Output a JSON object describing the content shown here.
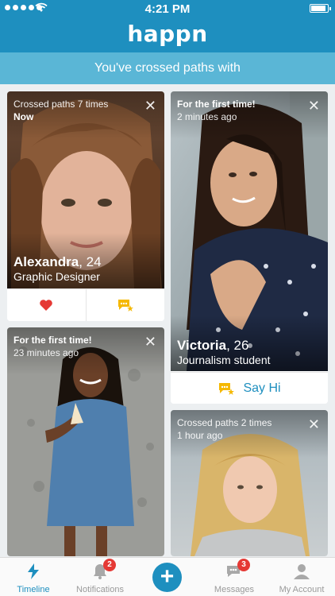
{
  "status": {
    "time": "4:21 PM"
  },
  "app": {
    "logo": "happn"
  },
  "subheader": "You've crossed paths with",
  "cards": [
    {
      "meta1": "Crossed paths 7 times",
      "meta2": "Now",
      "name": "Alexandra",
      "age": ", 24",
      "job": "Graphic Designer"
    },
    {
      "meta1": "For the first time!",
      "meta2": "2 minutes ago",
      "name": "Victoria",
      "age": ", 26",
      "job": "Journalism student",
      "action": "Say Hi"
    },
    {
      "meta1": "For the first time!",
      "meta2": "23 minutes ago"
    },
    {
      "meta1": "Crossed paths 2 times",
      "meta2": "1 hour ago"
    }
  ],
  "icons": {
    "close": "close-icon",
    "heart": "heart-icon",
    "charm": "charm-icon"
  },
  "colors": {
    "brand": "#1e8fbf",
    "subheader": "#5ab6d6",
    "heart": "#e53935",
    "charm": "#f5b800",
    "badge": "#e53935"
  },
  "tabs": [
    {
      "label": "Timeline",
      "icon": "bolt-icon",
      "active": true
    },
    {
      "label": "Notifications",
      "icon": "bell-icon",
      "badge": "2"
    },
    {
      "label": "",
      "icon": "plus-icon"
    },
    {
      "label": "Messages",
      "icon": "chat-icon",
      "badge": "3"
    },
    {
      "label": "My Account",
      "icon": "person-icon"
    }
  ]
}
